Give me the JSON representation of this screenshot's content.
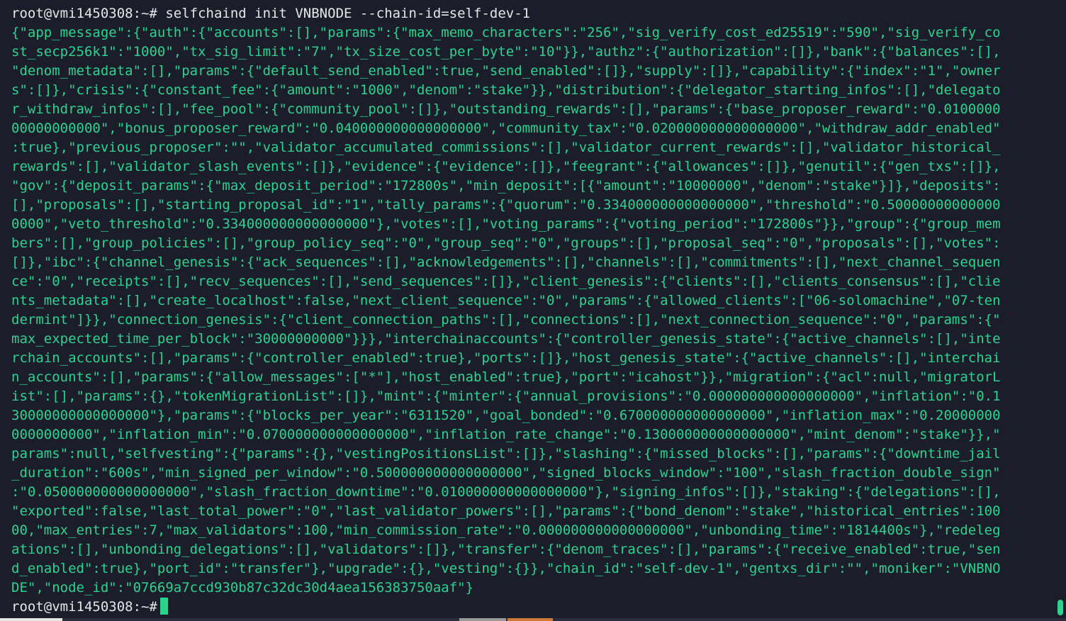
{
  "terminal": {
    "prompt": "root@vmi1450308:~#",
    "command": " selfchaind init VNBNODE --chain-id=self-dev-1",
    "output_lines": [
      "{\"app_message\":{\"auth\":{\"accounts\":[],\"params\":{\"max_memo_characters\":\"256\",\"sig_verify_cost_ed25519\":\"590\",\"sig_verify_co",
      "st_secp256k1\":\"1000\",\"tx_sig_limit\":\"7\",\"tx_size_cost_per_byte\":\"10\"}},\"authz\":{\"authorization\":[]},\"bank\":{\"balances\":[],",
      "\"denom_metadata\":[],\"params\":{\"default_send_enabled\":true,\"send_enabled\":[]},\"supply\":[]},\"capability\":{\"index\":\"1\",\"owner",
      "s\":[]},\"crisis\":{\"constant_fee\":{\"amount\":\"1000\",\"denom\":\"stake\"}},\"distribution\":{\"delegator_starting_infos\":[],\"delegato",
      "r_withdraw_infos\":[],\"fee_pool\":{\"community_pool\":[]},\"outstanding_rewards\":[],\"params\":{\"base_proposer_reward\":\"0.0100000",
      "00000000000\",\"bonus_proposer_reward\":\"0.040000000000000000\",\"community_tax\":\"0.020000000000000000\",\"withdraw_addr_enabled\"",
      ":true},\"previous_proposer\":\"\",\"validator_accumulated_commissions\":[],\"validator_current_rewards\":[],\"validator_historical_",
      "rewards\":[],\"validator_slash_events\":[]},\"evidence\":{\"evidence\":[]},\"feegrant\":{\"allowances\":[]},\"genutil\":{\"gen_txs\":[]},",
      "\"gov\":{\"deposit_params\":{\"max_deposit_period\":\"172800s\",\"min_deposit\":[{\"amount\":\"10000000\",\"denom\":\"stake\"}]},\"deposits\":",
      "[],\"proposals\":[],\"starting_proposal_id\":\"1\",\"tally_params\":{\"quorum\":\"0.334000000000000000\",\"threshold\":\"0.50000000000000",
      "0000\",\"veto_threshold\":\"0.334000000000000000\"},\"votes\":[],\"voting_params\":{\"voting_period\":\"172800s\"}},\"group\":{\"group_mem",
      "bers\":[],\"group_policies\":[],\"group_policy_seq\":\"0\",\"group_seq\":\"0\",\"groups\":[],\"proposal_seq\":\"0\",\"proposals\":[],\"votes\":",
      "[]},\"ibc\":{\"channel_genesis\":{\"ack_sequences\":[],\"acknowledgements\":[],\"channels\":[],\"commitments\":[],\"next_channel_sequen",
      "ce\":\"0\",\"receipts\":[],\"recv_sequences\":[],\"send_sequences\":[]},\"client_genesis\":{\"clients\":[],\"clients_consensus\":[],\"clie",
      "nts_metadata\":[],\"create_localhost\":false,\"next_client_sequence\":\"0\",\"params\":{\"allowed_clients\":[\"06-solomachine\",\"07-ten",
      "dermint\"]}},\"connection_genesis\":{\"client_connection_paths\":[],\"connections\":[],\"next_connection_sequence\":\"0\",\"params\":{\"",
      "max_expected_time_per_block\":\"30000000000\"}}},\"interchainaccounts\":{\"controller_genesis_state\":{\"active_channels\":[],\"inte",
      "rchain_accounts\":[],\"params\":{\"controller_enabled\":true},\"ports\":[]},\"host_genesis_state\":{\"active_channels\":[],\"interchai",
      "n_accounts\":[],\"params\":{\"allow_messages\":[\"*\"],\"host_enabled\":true},\"port\":\"icahost\"}},\"migration\":{\"acl\":null,\"migratorL",
      "ist\":[],\"params\":{},\"tokenMigrationList\":[]},\"mint\":{\"minter\":{\"annual_provisions\":\"0.000000000000000000\",\"inflation\":\"0.1",
      "30000000000000000\"},\"params\":{\"blocks_per_year\":\"6311520\",\"goal_bonded\":\"0.670000000000000000\",\"inflation_max\":\"0.20000000",
      "0000000000\",\"inflation_min\":\"0.070000000000000000\",\"inflation_rate_change\":\"0.130000000000000000\",\"mint_denom\":\"stake\"}},\"",
      "params\":null,\"selfvesting\":{\"params\":{},\"vestingPositionsList\":[]},\"slashing\":{\"missed_blocks\":[],\"params\":{\"downtime_jail",
      "_duration\":\"600s\",\"min_signed_per_window\":\"0.500000000000000000\",\"signed_blocks_window\":\"100\",\"slash_fraction_double_sign\"",
      ":\"0.050000000000000000\",\"slash_fraction_downtime\":\"0.010000000000000000\"},\"signing_infos\":[]},\"staking\":{\"delegations\":[],",
      "\"exported\":false,\"last_total_power\":\"0\",\"last_validator_powers\":[],\"params\":{\"bond_denom\":\"stake\",\"historical_entries\":100",
      "00,\"max_entries\":7,\"max_validators\":100,\"min_commission_rate\":\"0.000000000000000000\",\"unbonding_time\":\"1814400s\"},\"redeleg",
      "ations\":[],\"unbonding_delegations\":[],\"validators\":[]},\"transfer\":{\"denom_traces\":[],\"params\":{\"receive_enabled\":true,\"sen",
      "d_enabled\":true},\"port_id\":\"transfer\"},\"upgrade\":{},\"vesting\":{}},\"chain_id\":\"self-dev-1\",\"gentxs_dir\":\"\",\"moniker\":\"VNBNO",
      "DE\",\"node_id\":\"07669a7ccd930b87c32dc30d4aea156383750aaf\"}"
    ],
    "final_prompt": "root@vmi1450308:~#"
  }
}
